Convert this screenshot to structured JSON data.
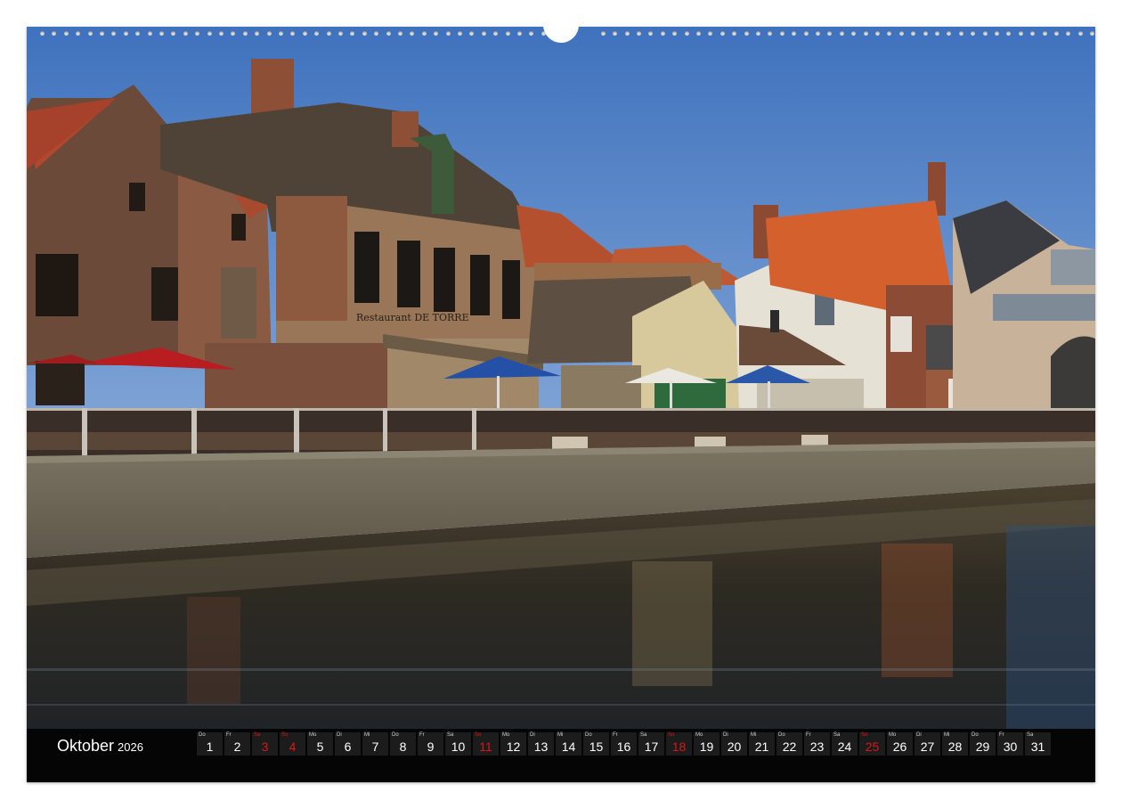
{
  "calendar": {
    "month": "Oktober",
    "year": "2026",
    "days": [
      {
        "weekday": "Do",
        "day": "1",
        "weekend": false
      },
      {
        "weekday": "Fr",
        "day": "2",
        "weekend": false
      },
      {
        "weekday": "Sa",
        "day": "3",
        "weekend": true
      },
      {
        "weekday": "So",
        "day": "4",
        "weekend": true
      },
      {
        "weekday": "Mo",
        "day": "5",
        "weekend": false
      },
      {
        "weekday": "Di",
        "day": "6",
        "weekend": false
      },
      {
        "weekday": "Mi",
        "day": "7",
        "weekend": false
      },
      {
        "weekday": "Do",
        "day": "8",
        "weekend": false
      },
      {
        "weekday": "Fr",
        "day": "9",
        "weekend": false
      },
      {
        "weekday": "Sa",
        "day": "10",
        "weekend": false
      },
      {
        "weekday": "So",
        "day": "11",
        "weekend": true
      },
      {
        "weekday": "Mo",
        "day": "12",
        "weekend": false
      },
      {
        "weekday": "Di",
        "day": "13",
        "weekend": false
      },
      {
        "weekday": "Mi",
        "day": "14",
        "weekend": false
      },
      {
        "weekday": "Do",
        "day": "15",
        "weekend": false
      },
      {
        "weekday": "Fr",
        "day": "16",
        "weekend": false
      },
      {
        "weekday": "Sa",
        "day": "17",
        "weekend": false
      },
      {
        "weekday": "So",
        "day": "18",
        "weekend": true
      },
      {
        "weekday": "Mo",
        "day": "19",
        "weekend": false
      },
      {
        "weekday": "Di",
        "day": "20",
        "weekend": false
      },
      {
        "weekday": "Mi",
        "day": "21",
        "weekend": false
      },
      {
        "weekday": "Do",
        "day": "22",
        "weekend": false
      },
      {
        "weekday": "Fr",
        "day": "23",
        "weekend": false
      },
      {
        "weekday": "Sa",
        "day": "24",
        "weekend": false
      },
      {
        "weekday": "So",
        "day": "25",
        "weekend": true
      },
      {
        "weekday": "Mo",
        "day": "26",
        "weekend": false
      },
      {
        "weekday": "Di",
        "day": "27",
        "weekend": false
      },
      {
        "weekday": "Mi",
        "day": "28",
        "weekend": false
      },
      {
        "weekday": "Do",
        "day": "29",
        "weekend": false
      },
      {
        "weekday": "Fr",
        "day": "30",
        "weekend": false
      },
      {
        "weekday": "Sa",
        "day": "31",
        "weekend": false
      }
    ]
  },
  "photo": {
    "sign_text": "Restaurant DE TORRE"
  },
  "colors": {
    "sky": "#4f80c4",
    "water": "#222a30",
    "weekend": "#d81818",
    "bar": "#050505"
  }
}
